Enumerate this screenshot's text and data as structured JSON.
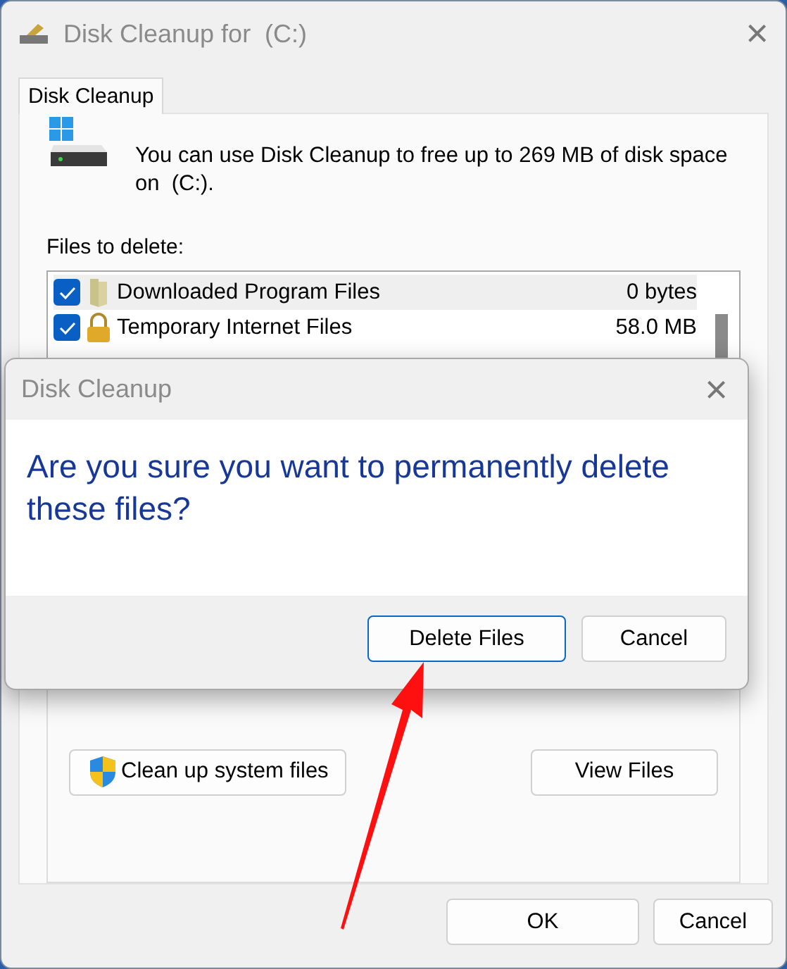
{
  "window": {
    "title": "Disk Cleanup for  (C:)",
    "close": "×"
  },
  "tabs": [
    {
      "label": "Disk Cleanup",
      "selected": true
    }
  ],
  "description": "You can use Disk Cleanup to free up to 269 MB of disk space on  (C:).",
  "files_label": "Files to delete:",
  "files": [
    {
      "name": "Downloaded Program Files",
      "size": "0 bytes",
      "checked": true,
      "selected": true
    },
    {
      "name": "Temporary Internet Files",
      "size": "58.0 MB",
      "checked": true,
      "selected": false
    }
  ],
  "panel_buttons": [
    {
      "label": "Clean up system files",
      "kind": "shield"
    },
    {
      "label": "View Files",
      "kind": "plain"
    }
  ],
  "footer_buttons": [
    {
      "label": "OK"
    },
    {
      "label": "Cancel"
    }
  ],
  "dialog": {
    "title": "Disk Cleanup",
    "close": "×",
    "message": "Are you sure you want to permanently delete these files?",
    "buttons": [
      {
        "label": "Delete Files",
        "default": true
      },
      {
        "label": "Cancel",
        "default": false
      }
    ]
  }
}
